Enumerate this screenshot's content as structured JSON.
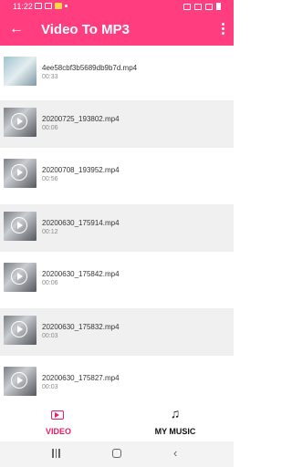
{
  "status_bar": {
    "time": "11:22"
  },
  "app_bar": {
    "back_icon": "arrow-left-icon",
    "title": "Video To MP3",
    "overflow_icon": "more-vertical-icon"
  },
  "videos": [
    {
      "name": "4ee58cbf3b5689db9b7d.mp4",
      "duration": "00:33"
    },
    {
      "name": "20200725_193802.mp4",
      "duration": "00:06"
    },
    {
      "name": "20200708_193952.mp4",
      "duration": "00:56"
    },
    {
      "name": "20200630_175914.mp4",
      "duration": "00:12"
    },
    {
      "name": "20200630_175842.mp4",
      "duration": "00:06"
    },
    {
      "name": "20200630_175832.mp4",
      "duration": "00:03"
    },
    {
      "name": "20200630_175827.mp4",
      "duration": "00:03"
    }
  ],
  "bottom_nav": {
    "video_label": "VIDEO",
    "music_label": "MY MUSIC",
    "active": "video",
    "active_color": "#e91e63"
  },
  "colors": {
    "primary": "#ff3d7f",
    "alt_row": "#f0f0f0"
  }
}
